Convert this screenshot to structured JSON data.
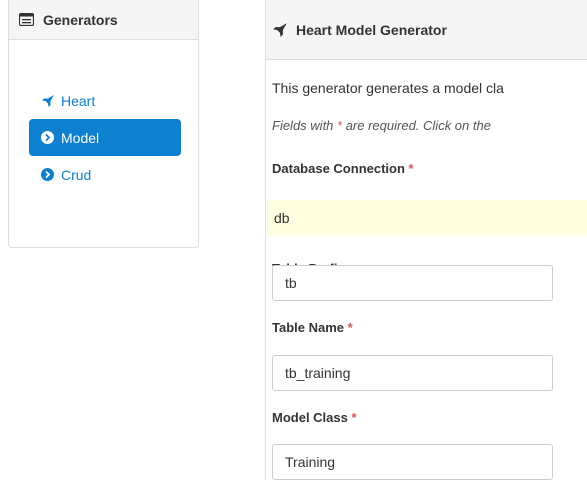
{
  "sidebar": {
    "header": {
      "title": "Generators",
      "icon": "list-icon"
    },
    "items": [
      {
        "label": "Heart",
        "icon": "rocket-icon",
        "active": false
      },
      {
        "label": "Model",
        "icon": "chevron-circle-right-icon",
        "active": true
      },
      {
        "label": "Crud",
        "icon": "chevron-circle-right-icon",
        "active": false
      }
    ]
  },
  "main": {
    "header": {
      "title": "Heart Model Generator",
      "icon": "rocket-icon"
    },
    "description": "This generator generates a model cla",
    "hint_before": "Fields with ",
    "hint_star": "*",
    "hint_after": " are required. Click on the",
    "fields": {
      "db_connection": {
        "label": "Database Connection",
        "required": "*",
        "value": "db"
      },
      "table_prefix": {
        "label": "Table Prefix",
        "value": "tb"
      },
      "table_name": {
        "label": "Table Name",
        "required": "*",
        "value": "tb_training"
      },
      "model_class": {
        "label": "Model Class",
        "required": "*",
        "value": "Training"
      }
    }
  },
  "colors": {
    "accent": "#0e80d0",
    "link": "#0e7fd0",
    "required": "#d9534f",
    "sticky_bg": "#ffffe0",
    "panel_header": "#f5f5f5"
  }
}
